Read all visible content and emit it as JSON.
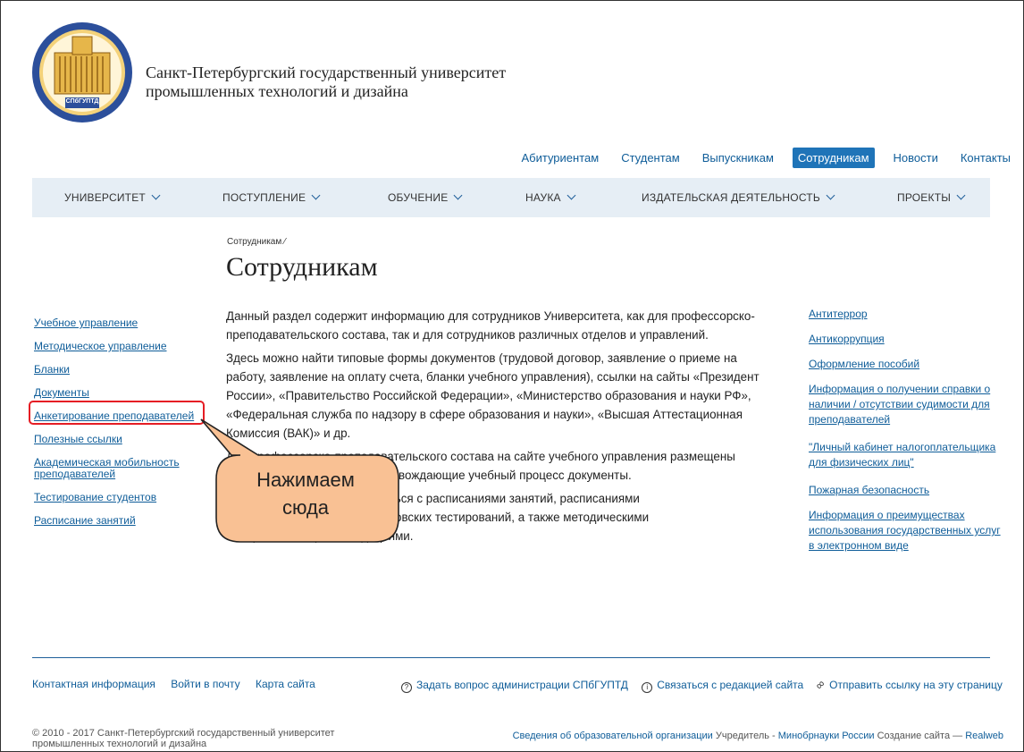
{
  "header": {
    "logo_text": "СПбГУПТД",
    "university_line1": "Санкт-Петербургский государственный университет",
    "university_line2": "промышленных технологий и дизайна"
  },
  "topnav": [
    "Абитуриентам",
    "Студентам",
    "Выпускникам",
    "Сотрудникам",
    "Новости",
    "Контакты"
  ],
  "topnav_active": "Сотрудникам",
  "mainnav": [
    "УНИВЕРСИТЕТ",
    "ПОСТУПЛЕНИЕ",
    "ОБУЧЕНИЕ",
    "НАУКА",
    "ИЗДАТЕЛЬСКАЯ ДЕЯТЕЛЬНОСТЬ",
    "ПРОЕКТЫ"
  ],
  "breadcrumb": "Сотрудникам ⁄",
  "page_title": "Сотрудникам",
  "sidebar": [
    "Учебное управление",
    "Методическое управление",
    "Бланки",
    "Документы",
    "Анкетирование преподавателей",
    "Полезные ссылки",
    "Академическая мобильность",
    "преподавателей",
    "Тестирование студентов",
    "Расписание занятий"
  ],
  "content": {
    "p1_l1": "Данный раздел содержит информацию для сотрудников Университета, как для профессорско-",
    "p1_l2": "преподавательского состава, так и для сотрудников различных отделов и управлений.",
    "p2_l1": "Здесь можно найти типовые формы документов (трудовой договор, заявление о приеме на",
    "p2_l2": "работу, заявление на оплату счета, бланки учебного управления), ссылки на сайты «Президент",
    "p2_l3": "России», «Правительство Российской Федерации», «Министерство образования и науки РФ»,",
    "p2_l4": "«Федеральная служба по надзору в сфере образования и науки», «Высшая Аттестационная",
    "p2_l5": "Комиссия (ВАК)» и др.",
    "p3_l1": "Для профессорско-преподавательского состава на сайте учебного управления размещены",
    "p3_l2": "учебные планы и другие сопровождающие учебный процесс документы.",
    "p4_l1": "Здесь также можно ознакомиться с расписаниями занятий, расписаниями",
    "p4_l2": "экзаменов, ФЭПО и внутривузовских тестирований, а также методическими",
    "p4_l3": "материалами и рекомендациями."
  },
  "rightlinks": [
    "Антитеррор",
    "Антикоррупция",
    "Оформление пособий",
    "Информация о получении справки о",
    "наличии / отсутствии судимости для",
    "преподавателей",
    "\"Личный кабинет налогоплательщика",
    "для физических лиц\"",
    "Пожарная безопасность",
    "Информация о преимуществах",
    "использования государственных услуг",
    "в электронном виде"
  ],
  "callout": {
    "line1": "Нажимаем",
    "line2": "сюда",
    "color": "#f9c194",
    "stroke": "#222222"
  },
  "highlight_color": "#e51d24",
  "footer": {
    "contacts": "Контактная информация",
    "mail": "Войти в почту",
    "sitemap": "Карта сайта",
    "ask": "Задать вопрос администрации СПбГУПТД",
    "contact_editors": "Связаться с редакцией сайта",
    "share": "Отправить ссылку на эту страницу",
    "copyright_l1": "© 2010 - 2017 Санкт-Петербургский государственный университет",
    "copyright_l2": "промышленных технологий и дизайна",
    "edu_info": "Сведения об образовательной организации",
    "founder_label": "Учредитель -",
    "founder": "Минобрнауки России",
    "created_label": "Создание сайта —",
    "creator": "Realweb"
  },
  "colors": {
    "link": "#0f5d99",
    "nav_bg": "#e6eef5",
    "active_tab": "#1f74b8"
  }
}
